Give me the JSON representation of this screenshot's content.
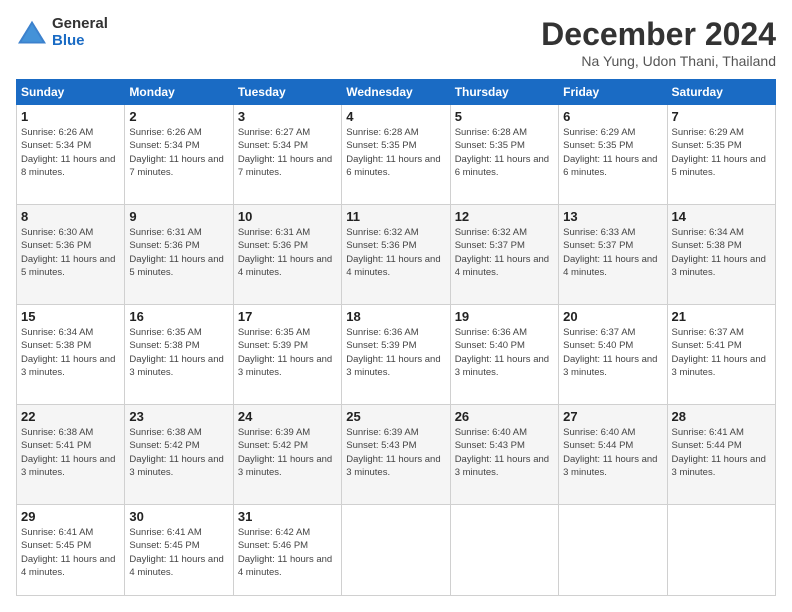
{
  "logo": {
    "general": "General",
    "blue": "Blue"
  },
  "header": {
    "title": "December 2024",
    "subtitle": "Na Yung, Udon Thani, Thailand"
  },
  "weekdays": [
    "Sunday",
    "Monday",
    "Tuesday",
    "Wednesday",
    "Thursday",
    "Friday",
    "Saturday"
  ],
  "weeks": [
    [
      {
        "day": "1",
        "sunrise": "6:26 AM",
        "sunset": "5:34 PM",
        "daylight": "11 hours and 8 minutes."
      },
      {
        "day": "2",
        "sunrise": "6:26 AM",
        "sunset": "5:34 PM",
        "daylight": "11 hours and 7 minutes."
      },
      {
        "day": "3",
        "sunrise": "6:27 AM",
        "sunset": "5:34 PM",
        "daylight": "11 hours and 7 minutes."
      },
      {
        "day": "4",
        "sunrise": "6:28 AM",
        "sunset": "5:35 PM",
        "daylight": "11 hours and 6 minutes."
      },
      {
        "day": "5",
        "sunrise": "6:28 AM",
        "sunset": "5:35 PM",
        "daylight": "11 hours and 6 minutes."
      },
      {
        "day": "6",
        "sunrise": "6:29 AM",
        "sunset": "5:35 PM",
        "daylight": "11 hours and 6 minutes."
      },
      {
        "day": "7",
        "sunrise": "6:29 AM",
        "sunset": "5:35 PM",
        "daylight": "11 hours and 5 minutes."
      }
    ],
    [
      {
        "day": "8",
        "sunrise": "6:30 AM",
        "sunset": "5:36 PM",
        "daylight": "11 hours and 5 minutes."
      },
      {
        "day": "9",
        "sunrise": "6:31 AM",
        "sunset": "5:36 PM",
        "daylight": "11 hours and 5 minutes."
      },
      {
        "day": "10",
        "sunrise": "6:31 AM",
        "sunset": "5:36 PM",
        "daylight": "11 hours and 4 minutes."
      },
      {
        "day": "11",
        "sunrise": "6:32 AM",
        "sunset": "5:36 PM",
        "daylight": "11 hours and 4 minutes."
      },
      {
        "day": "12",
        "sunrise": "6:32 AM",
        "sunset": "5:37 PM",
        "daylight": "11 hours and 4 minutes."
      },
      {
        "day": "13",
        "sunrise": "6:33 AM",
        "sunset": "5:37 PM",
        "daylight": "11 hours and 4 minutes."
      },
      {
        "day": "14",
        "sunrise": "6:34 AM",
        "sunset": "5:38 PM",
        "daylight": "11 hours and 3 minutes."
      }
    ],
    [
      {
        "day": "15",
        "sunrise": "6:34 AM",
        "sunset": "5:38 PM",
        "daylight": "11 hours and 3 minutes."
      },
      {
        "day": "16",
        "sunrise": "6:35 AM",
        "sunset": "5:38 PM",
        "daylight": "11 hours and 3 minutes."
      },
      {
        "day": "17",
        "sunrise": "6:35 AM",
        "sunset": "5:39 PM",
        "daylight": "11 hours and 3 minutes."
      },
      {
        "day": "18",
        "sunrise": "6:36 AM",
        "sunset": "5:39 PM",
        "daylight": "11 hours and 3 minutes."
      },
      {
        "day": "19",
        "sunrise": "6:36 AM",
        "sunset": "5:40 PM",
        "daylight": "11 hours and 3 minutes."
      },
      {
        "day": "20",
        "sunrise": "6:37 AM",
        "sunset": "5:40 PM",
        "daylight": "11 hours and 3 minutes."
      },
      {
        "day": "21",
        "sunrise": "6:37 AM",
        "sunset": "5:41 PM",
        "daylight": "11 hours and 3 minutes."
      }
    ],
    [
      {
        "day": "22",
        "sunrise": "6:38 AM",
        "sunset": "5:41 PM",
        "daylight": "11 hours and 3 minutes."
      },
      {
        "day": "23",
        "sunrise": "6:38 AM",
        "sunset": "5:42 PM",
        "daylight": "11 hours and 3 minutes."
      },
      {
        "day": "24",
        "sunrise": "6:39 AM",
        "sunset": "5:42 PM",
        "daylight": "11 hours and 3 minutes."
      },
      {
        "day": "25",
        "sunrise": "6:39 AM",
        "sunset": "5:43 PM",
        "daylight": "11 hours and 3 minutes."
      },
      {
        "day": "26",
        "sunrise": "6:40 AM",
        "sunset": "5:43 PM",
        "daylight": "11 hours and 3 minutes."
      },
      {
        "day": "27",
        "sunrise": "6:40 AM",
        "sunset": "5:44 PM",
        "daylight": "11 hours and 3 minutes."
      },
      {
        "day": "28",
        "sunrise": "6:41 AM",
        "sunset": "5:44 PM",
        "daylight": "11 hours and 3 minutes."
      }
    ],
    [
      {
        "day": "29",
        "sunrise": "6:41 AM",
        "sunset": "5:45 PM",
        "daylight": "11 hours and 4 minutes."
      },
      {
        "day": "30",
        "sunrise": "6:41 AM",
        "sunset": "5:45 PM",
        "daylight": "11 hours and 4 minutes."
      },
      {
        "day": "31",
        "sunrise": "6:42 AM",
        "sunset": "5:46 PM",
        "daylight": "11 hours and 4 minutes."
      },
      null,
      null,
      null,
      null
    ]
  ],
  "labels": {
    "sunrise": "Sunrise:",
    "sunset": "Sunset:",
    "daylight": "Daylight:"
  }
}
